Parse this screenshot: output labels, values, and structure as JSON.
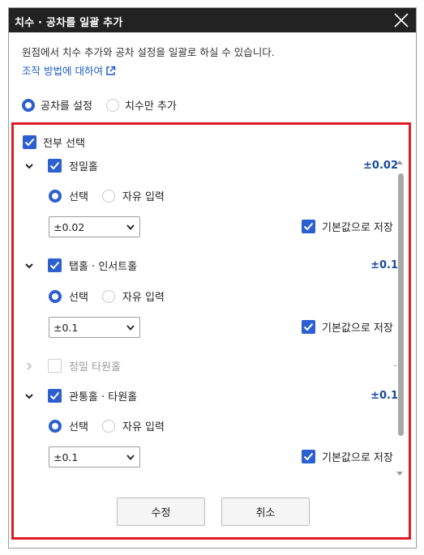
{
  "dialog": {
    "title": "치수 · 공차를 일괄 추가",
    "description": "원점에서 치수 추가와 공차 설정을 일괄로 하실 수 있습니다.",
    "help_link": "조작 방법에 대하여",
    "mode_options": [
      {
        "label": "공차를 설정",
        "selected": true
      },
      {
        "label": "치수만 추가",
        "selected": false
      }
    ],
    "select_all_label": "전부 선택",
    "input_option_labels": {
      "select": "선택",
      "free_input": "자유 입력"
    },
    "save_default_label": "기본값으로 저장",
    "groups": [
      {
        "name": "정밀홀",
        "checked": true,
        "expanded": true,
        "tolerance": "±0.02",
        "selected_value": "±0.02",
        "save_default": true
      },
      {
        "name": "탭홀 · 인서트홀",
        "checked": true,
        "expanded": true,
        "tolerance": "±0.1",
        "selected_value": "±0.1",
        "save_default": true
      },
      {
        "name": "정밀 타원홀",
        "checked": false,
        "expanded": false,
        "tolerance": "-"
      },
      {
        "name": "관통홀 · 타원홀",
        "checked": true,
        "expanded": true,
        "tolerance": "±0.1",
        "selected_value": "±0.1",
        "save_default": true
      }
    ],
    "buttons": {
      "modify": "수정",
      "cancel": "취소"
    }
  }
}
